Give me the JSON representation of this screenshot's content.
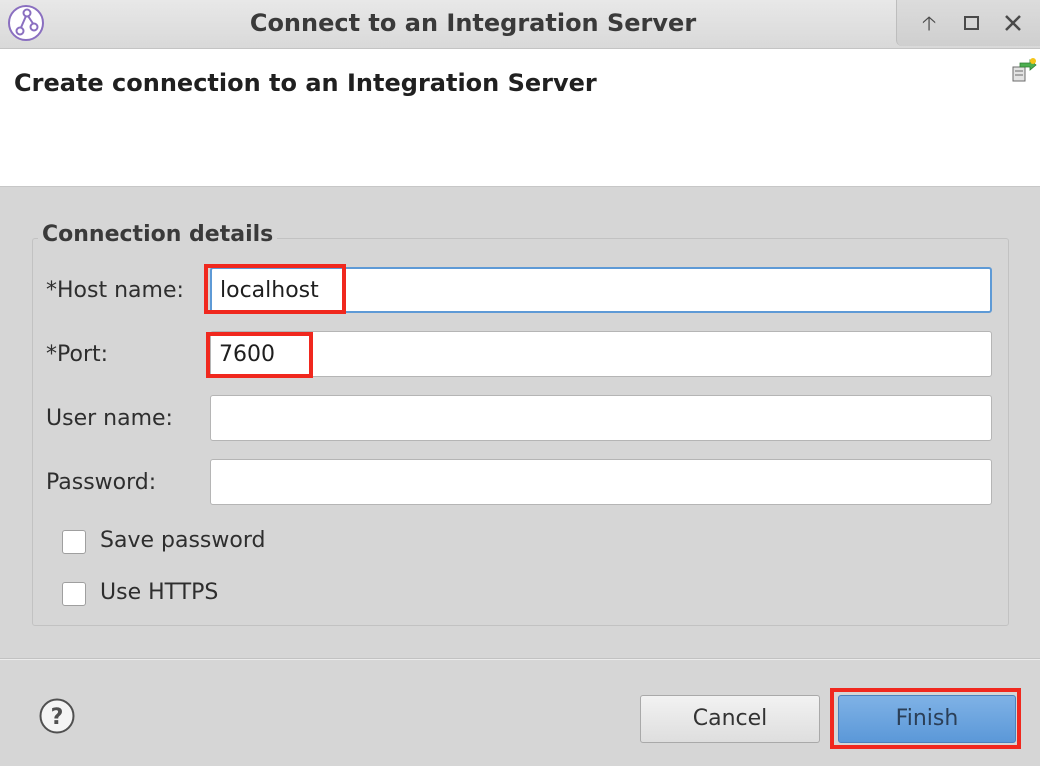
{
  "window": {
    "title": "Connect to an Integration Server",
    "controls": [
      "restore-up",
      "maximize",
      "close"
    ]
  },
  "banner": {
    "title": "Create connection to an Integration Server"
  },
  "connection": {
    "group_label": "Connection details",
    "host_label": "*Host name:",
    "host_value": "localhost",
    "port_label": "*Port:",
    "port_value": "7600",
    "user_label": "User name:",
    "user_value": "",
    "password_label": "Password:",
    "password_value": "",
    "save_password_label": "Save password",
    "save_password_checked": false,
    "https_label": "Use HTTPS",
    "https_checked": false
  },
  "footer": {
    "help_glyph": "?",
    "cancel_label": "Cancel",
    "finish_label": "Finish"
  },
  "colors": {
    "highlight": "#f0281e",
    "finish_button": "#6ea6df",
    "focus_border": "#5e9ad6"
  }
}
